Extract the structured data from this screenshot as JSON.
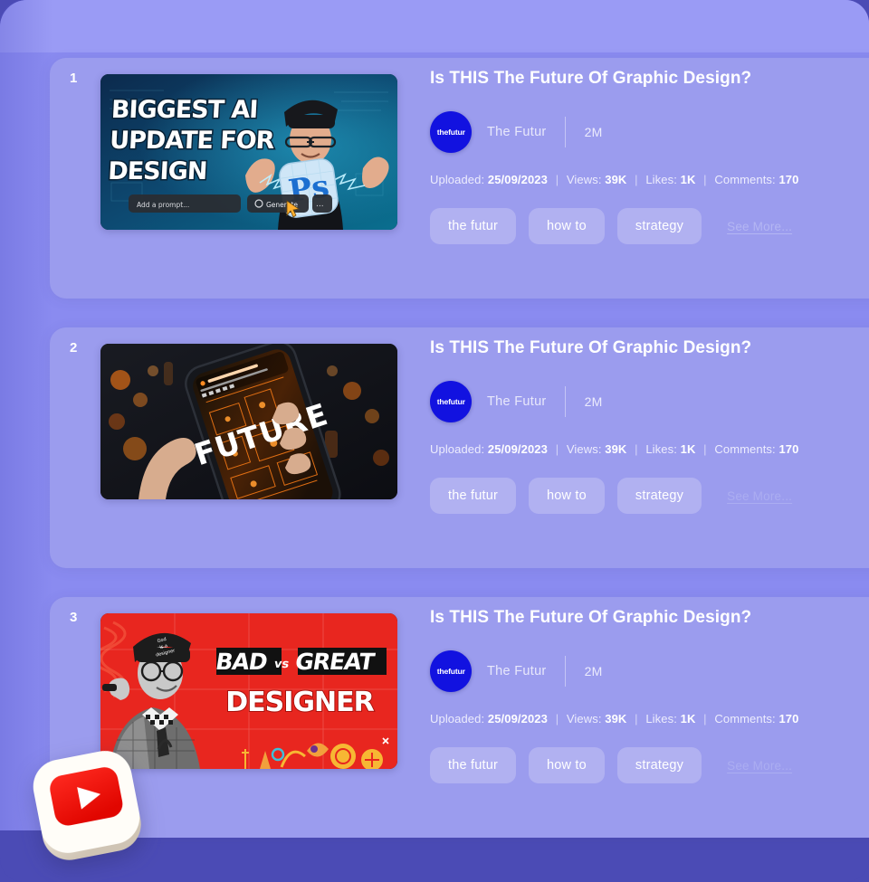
{
  "colors": {
    "page_background": "#4b4bb5",
    "sheet_background": "#8a8bf0",
    "card_background": "#9b9cee",
    "avatar_blue": "#1212e0",
    "youtube_red": "#ff0000",
    "text_white": "#ffffff",
    "link_lavender": "#b9bbf4"
  },
  "icons": {
    "youtube_badge": "youtube-play-icon",
    "channel_avatar": "thefutur-avatar-icon"
  },
  "channel": {
    "avatar_text": "thefutur",
    "name": "The Futur",
    "subscribers": "2M"
  },
  "meta_labels": {
    "uploaded": "Uploaded:",
    "views": "Views:",
    "likes": "Likes:",
    "comments": "Comments:",
    "separator": "|"
  },
  "see_more_label": "See More...",
  "cards": [
    {
      "rank": "1",
      "title": "Is THIS The Future Of Graphic Design?",
      "thumbnail": {
        "id": "biggest-ai-update-for-design-thumbnail",
        "headline_lines": [
          "BIGGEST AI",
          "UPDATE FOR",
          "DESIGN"
        ],
        "overlay_prompt": "Add a prompt...",
        "overlay_button": "Generate",
        "overlay_more": "...",
        "badge": "Ps"
      },
      "channel": {
        "avatar_text": "thefutur",
        "name": "The Futur",
        "subscribers": "2M"
      },
      "stats": {
        "uploaded": "25/09/2023",
        "views": "39K",
        "likes": "1K",
        "comments": "170"
      },
      "tags": [
        "the futur",
        "how to",
        "strategy"
      ],
      "see_more": "See More...",
      "see_more_faded": false
    },
    {
      "rank": "2",
      "title": "Is THIS The Future Of Graphic Design?",
      "thumbnail": {
        "id": "future-phone-thumbnail",
        "headline_lines": [
          "FUTURE"
        ],
        "overlay_prompt": "",
        "overlay_button": "",
        "overlay_more": "",
        "badge": ""
      },
      "channel": {
        "avatar_text": "thefutur",
        "name": "The Futur",
        "subscribers": "2M"
      },
      "stats": {
        "uploaded": "25/09/2023",
        "views": "39K",
        "likes": "1K",
        "comments": "170"
      },
      "tags": [
        "the futur",
        "how to",
        "strategy"
      ],
      "see_more": "See More...",
      "see_more_faded": true
    },
    {
      "rank": "3",
      "title": "Is THIS The Future Of Graphic Design?",
      "thumbnail": {
        "id": "bad-vs-great-designer-thumbnail",
        "headline_lines": [
          "BAD",
          "vs",
          "GREAT",
          "DESIGNER"
        ],
        "overlay_prompt": "",
        "overlay_button": "",
        "overlay_more": "",
        "badge": "God is a designer"
      },
      "channel": {
        "avatar_text": "thefutur",
        "name": "The Futur",
        "subscribers": "2M"
      },
      "stats": {
        "uploaded": "25/09/2023",
        "views": "39K",
        "likes": "1K",
        "comments": "170"
      },
      "tags": [
        "the futur",
        "how to",
        "strategy"
      ],
      "see_more": "See More...",
      "see_more_faded": true
    }
  ]
}
